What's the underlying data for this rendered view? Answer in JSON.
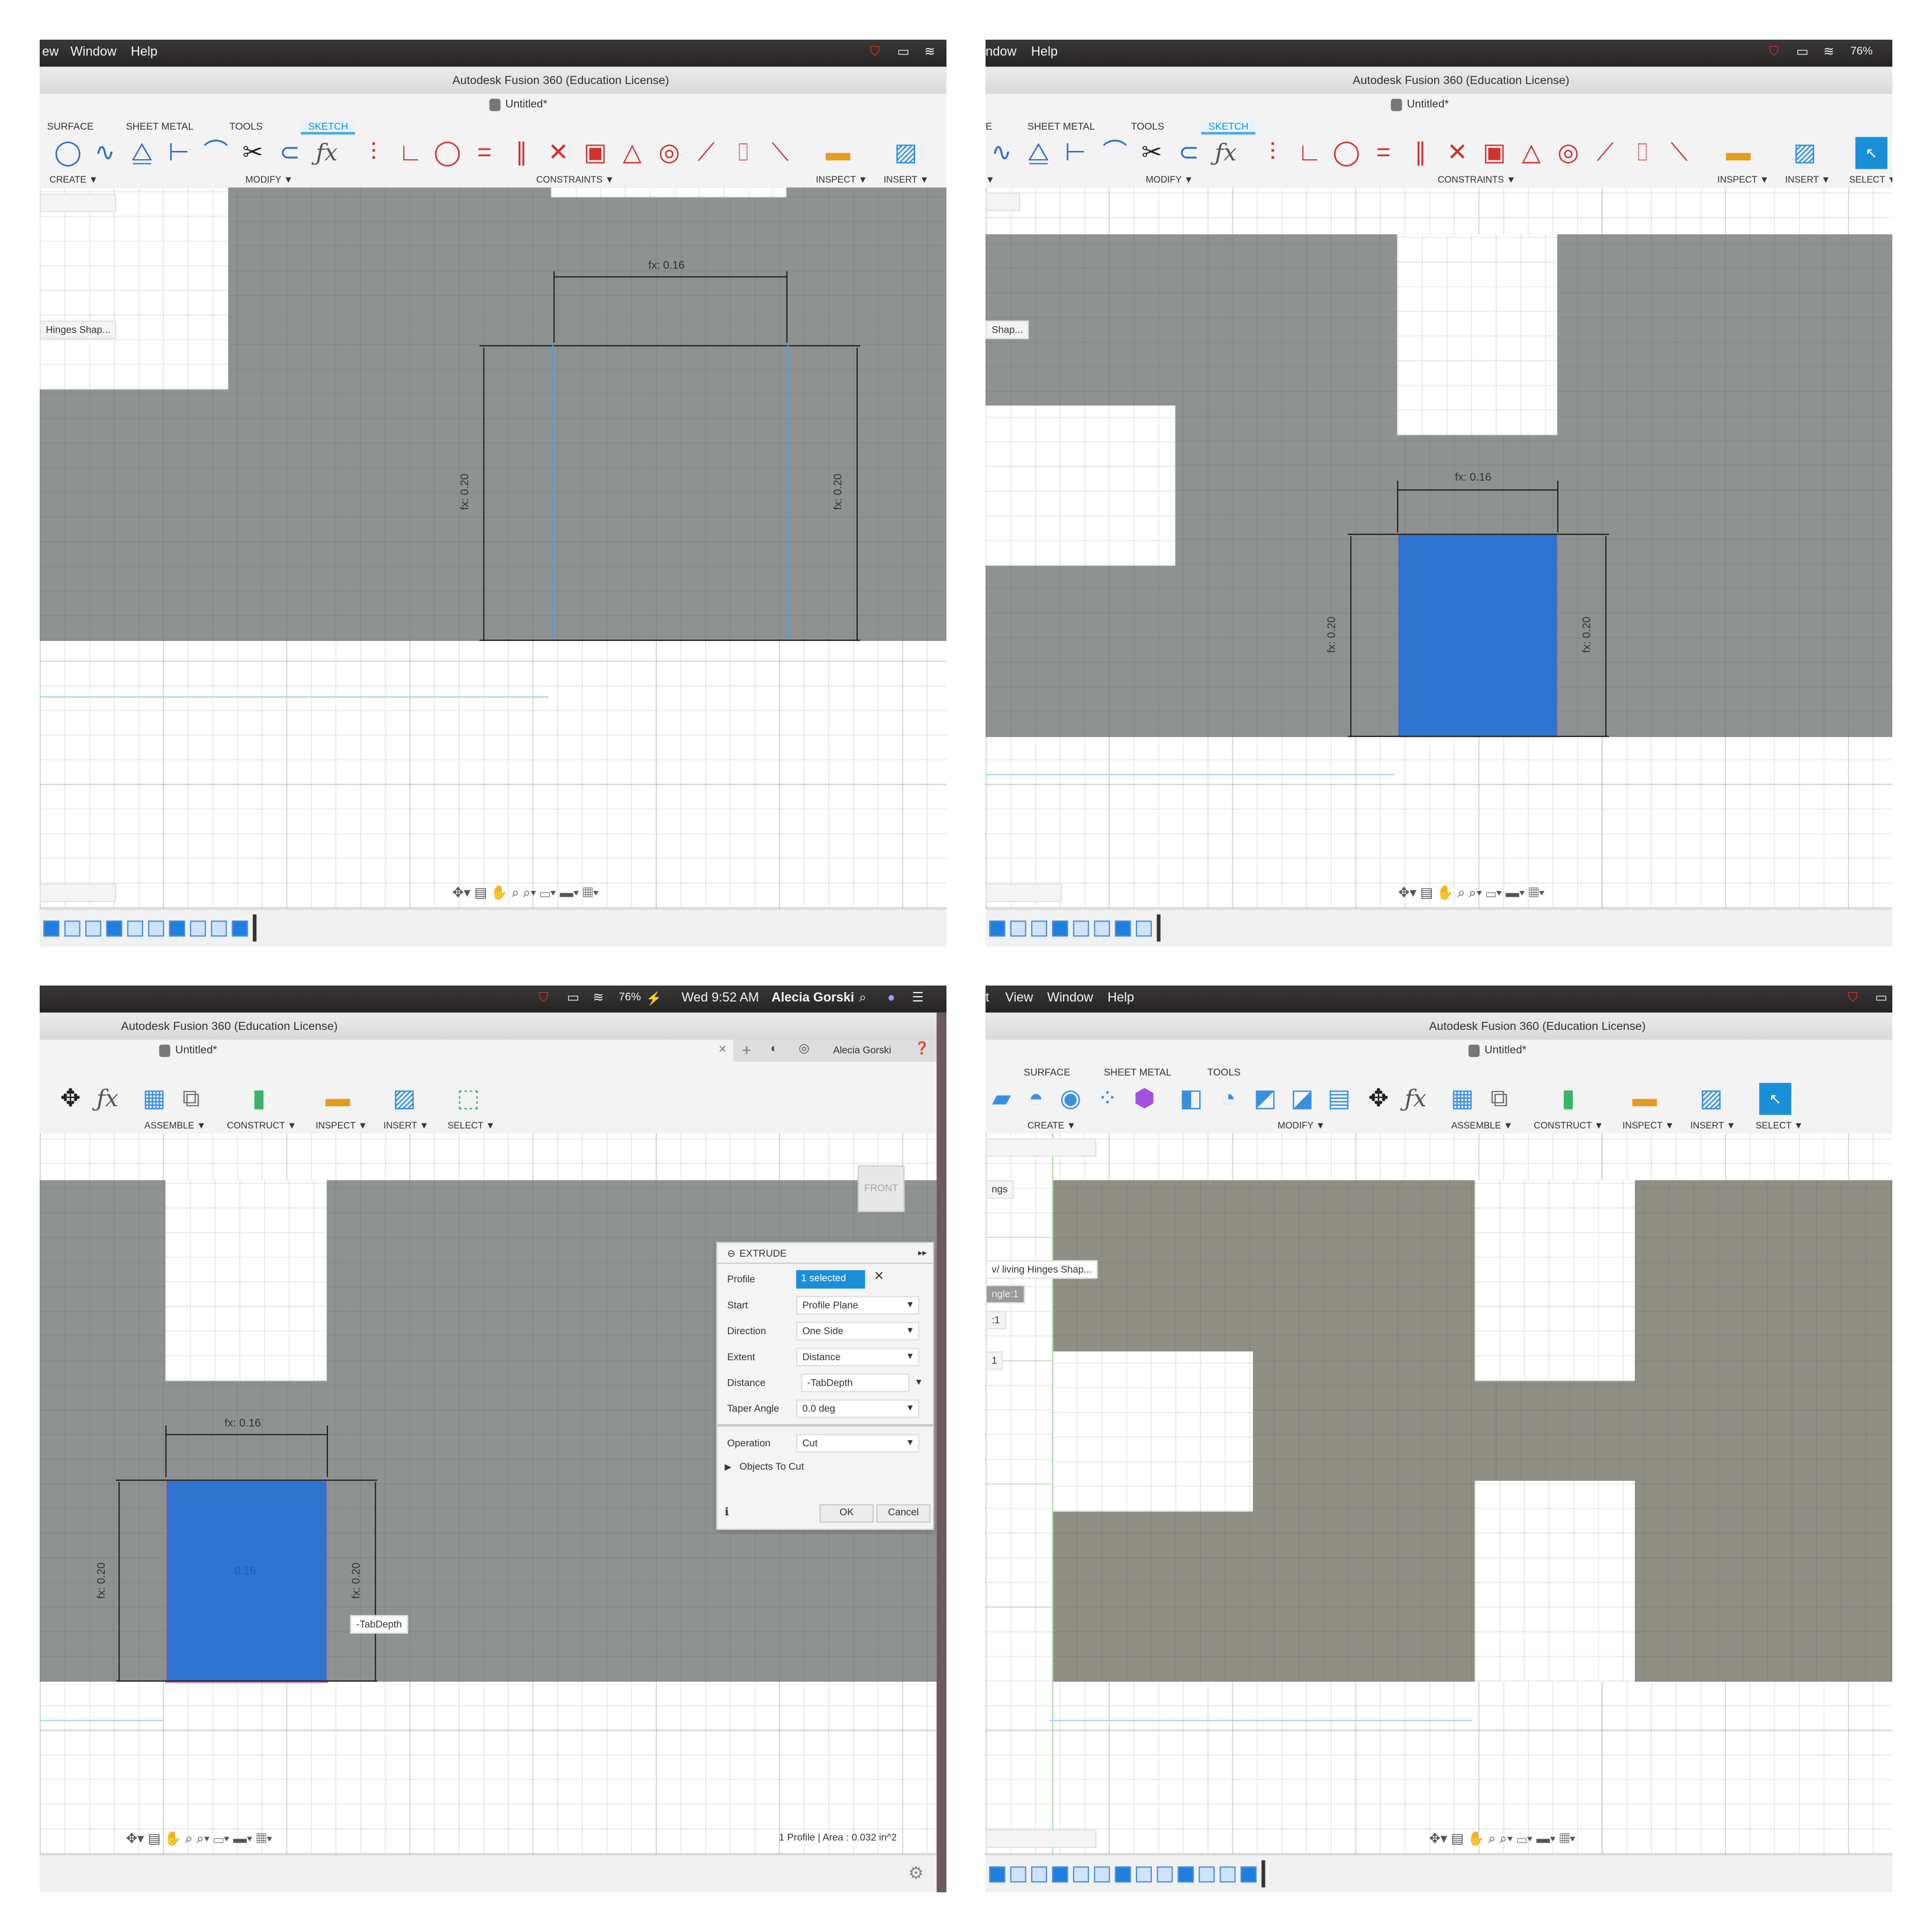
{
  "colors": {
    "accent": "#1a8fd8",
    "sketch_gray": "#8e9391",
    "body_gray": "#908f86",
    "profile_blue": "#2e73d0",
    "selection_red": "#e0707a",
    "menubar": "#2c2a2b"
  },
  "panels": [
    {
      "menubar_left": [
        "ew",
        "Window",
        "Help"
      ],
      "menubar_right_icons": [
        "mcafee-icon",
        "airplay-icon",
        "wifi-icon"
      ],
      "title": "Autodesk Fusion 360 (Education License)",
      "doc_tab": "Untitled*",
      "tabs": [
        "SURFACE",
        "SHEET METAL",
        "TOOLS",
        "SKETCH"
      ],
      "active_tab": 3,
      "groups": [
        "CREATE ▼",
        "MODIFY ▼",
        "CONSTRAINTS ▼",
        "INSPECT ▼",
        "INSERT ▼"
      ],
      "icons": [
        {
          "name": "circle-icon",
          "glyph": "◯",
          "color": "#2a6fc9"
        },
        {
          "name": "spline-icon",
          "glyph": "∿",
          "color": "#2a6fc9"
        },
        {
          "name": "mirror-icon",
          "glyph": "⧋",
          "color": "#2a6fc9"
        },
        {
          "name": "sketch-dimension-icon",
          "glyph": "⊢",
          "color": "#2a6fc9"
        },
        {
          "name": "fillet-icon",
          "glyph": "⌒",
          "color": "#2a6fc9"
        },
        {
          "name": "trim-icon",
          "glyph": "✂",
          "color": "#222"
        },
        {
          "name": "offset-icon",
          "glyph": "⊂",
          "color": "#2a6fc9"
        },
        {
          "name": "fx-icon",
          "glyph": "ƒx",
          "color": "#555"
        },
        {
          "name": "fix-constraint-icon",
          "glyph": "⫶",
          "color": "#d23030"
        },
        {
          "name": "perpendicular-icon",
          "glyph": "∟",
          "color": "#d23030"
        },
        {
          "name": "tangent-icon",
          "glyph": "◯",
          "color": "#d23030"
        },
        {
          "name": "equal-icon",
          "glyph": "=",
          "color": "#d23030"
        },
        {
          "name": "parallel-icon",
          "glyph": "∥",
          "color": "#d23030"
        },
        {
          "name": "collinear-icon",
          "glyph": "✕",
          "color": "#d23030"
        },
        {
          "name": "lock-icon",
          "glyph": "▣",
          "color": "#d23030"
        },
        {
          "name": "triangle-icon",
          "glyph": "△",
          "color": "#d23030"
        },
        {
          "name": "concentric-icon",
          "glyph": "◎",
          "color": "#d23030"
        },
        {
          "name": "midpoint-icon",
          "glyph": "⟋",
          "color": "#d23030"
        },
        {
          "name": "symmetry-icon",
          "glyph": "⌷",
          "color": "#d23030"
        },
        {
          "name": "smooth-icon",
          "glyph": "⟍",
          "color": "#d23030"
        },
        {
          "name": "measure-icon",
          "glyph": "▬",
          "color": "#e59a20"
        },
        {
          "name": "insert-image-icon",
          "glyph": "▨",
          "color": "#2a8fe0"
        }
      ],
      "browser": [
        "Hinges Shap..."
      ],
      "dims": {
        "width": "fx: 0.16",
        "height_left": "fx: 0.20",
        "height_right": "fx: 0.20"
      }
    },
    {
      "menubar_left": [
        "ndow",
        "Help"
      ],
      "menubar_right": [
        "76%"
      ],
      "title": "Autodesk Fusion 360 (Education License)",
      "doc_tab": "Untitled*",
      "tabs": [
        "E",
        "SHEET METAL",
        "TOOLS",
        "SKETCH"
      ],
      "active_tab": 3,
      "groups": [
        "▼",
        "MODIFY ▼",
        "CONSTRAINTS ▼",
        "INSPECT ▼",
        "INSERT ▼",
        "SELECT ▼"
      ],
      "icons": [
        {
          "name": "spline-icon",
          "glyph": "∿",
          "color": "#2a6fc9"
        },
        {
          "name": "mirror-icon",
          "glyph": "⧋",
          "color": "#2a6fc9"
        },
        {
          "name": "sketch-dimension-icon",
          "glyph": "⊢",
          "color": "#2a6fc9"
        },
        {
          "name": "fillet-icon",
          "glyph": "⌒",
          "color": "#2a6fc9"
        },
        {
          "name": "trim-icon",
          "glyph": "✂",
          "color": "#222"
        },
        {
          "name": "offset-icon",
          "glyph": "⊂",
          "color": "#2a6fc9"
        },
        {
          "name": "fx-icon",
          "glyph": "ƒx",
          "color": "#555"
        },
        {
          "name": "fix-constraint-icon",
          "glyph": "⫶",
          "color": "#d23030"
        },
        {
          "name": "perpendicular-icon",
          "glyph": "∟",
          "color": "#d23030"
        },
        {
          "name": "tangent-icon",
          "glyph": "◯",
          "color": "#d23030"
        },
        {
          "name": "equal-icon",
          "glyph": "=",
          "color": "#d23030"
        },
        {
          "name": "parallel-icon",
          "glyph": "∥",
          "color": "#d23030"
        },
        {
          "name": "collinear-icon",
          "glyph": "✕",
          "color": "#d23030"
        },
        {
          "name": "lock-icon",
          "glyph": "▣",
          "color": "#d23030"
        },
        {
          "name": "triangle-icon",
          "glyph": "△",
          "color": "#d23030"
        },
        {
          "name": "concentric-icon",
          "glyph": "◎",
          "color": "#d23030"
        },
        {
          "name": "midpoint-icon",
          "glyph": "⟋",
          "color": "#d23030"
        },
        {
          "name": "symmetry-icon",
          "glyph": "⌷",
          "color": "#d23030"
        },
        {
          "name": "smooth-icon",
          "glyph": "⟍",
          "color": "#d23030"
        },
        {
          "name": "measure-icon",
          "glyph": "▬",
          "color": "#e59a20"
        },
        {
          "name": "insert-image-icon",
          "glyph": "▨",
          "color": "#2a8fe0"
        },
        {
          "name": "select-icon",
          "glyph": "▪",
          "color": "#1a8fd8"
        }
      ],
      "browser": [
        "Shap..."
      ],
      "dims": {
        "width": "fx: 0.16",
        "height_left": "fx: 0.20",
        "height_right": "fx: 0.20"
      }
    },
    {
      "menubar_right": [
        "76%",
        "Wed 9:52 AM",
        "Alecia Gorski"
      ],
      "menubar_right_icons": [
        "mcafee-icon",
        "airplay-icon",
        "wifi-icon",
        "battery-icon",
        "search-icon",
        "siri-icon",
        "list-icon"
      ],
      "title": "Autodesk Fusion 360 (Education License)",
      "doc_tab": "Untitled*",
      "user": "Alecia Gorski",
      "groups": [
        "ASSEMBLE ▼",
        "CONSTRUCT ▼",
        "INSPECT ▼",
        "INSERT ▼",
        "SELECT ▼"
      ],
      "icons": [
        {
          "name": "move-icon",
          "glyph": "✥",
          "color": "#222"
        },
        {
          "name": "fx-icon",
          "glyph": "ƒx",
          "color": "#555"
        },
        {
          "name": "new-component-icon",
          "glyph": "▦",
          "color": "#3a8fe0"
        },
        {
          "name": "joint-icon",
          "glyph": "⧉",
          "color": "#777"
        },
        {
          "name": "construct-plane-icon",
          "glyph": "▮",
          "color": "#3bb36a"
        },
        {
          "name": "measure-icon",
          "glyph": "▬",
          "color": "#e59a20"
        },
        {
          "name": "insert-image-icon",
          "glyph": "▨",
          "color": "#2a8fe0"
        },
        {
          "name": "select-icon",
          "glyph": "⬚",
          "color": "#3bb36a"
        }
      ],
      "viewcube": "FRONT",
      "dims": {
        "width": "fx: 0.16",
        "height_left": "fx: 0.20",
        "height_right": "fx: 0.20",
        "center": "0.16"
      },
      "tooltip": "-TabDepth",
      "extrude": {
        "title": "EXTRUDE",
        "rows": [
          {
            "label": "Profile",
            "value": "1 selected"
          },
          {
            "label": "Start",
            "value": "Profile Plane"
          },
          {
            "label": "Direction",
            "value": "One Side"
          },
          {
            "label": "Extent",
            "value": "Distance"
          },
          {
            "label": "Distance",
            "value": "-TabDepth"
          },
          {
            "label": "Taper Angle",
            "value": "0.0 deg"
          },
          {
            "label": "Operation",
            "value": "Cut"
          }
        ],
        "objects": "Objects To Cut",
        "ok": "OK",
        "cancel": "Cancel"
      },
      "status": "1 Profile | Area : 0.032 in^2"
    },
    {
      "menubar_left": [
        "t",
        "View",
        "Window",
        "Help"
      ],
      "title": "Autodesk Fusion 360 (Education License)",
      "doc_tab": "Untitled*",
      "tabs": [
        "SURFACE",
        "SHEET METAL",
        "TOOLS"
      ],
      "groups": [
        "CREATE ▼",
        "MODIFY ▼",
        "ASSEMBLE ▼",
        "CONSTRUCT ▼",
        "INSPECT ▼",
        "INSERT ▼",
        "SELECT ▼"
      ],
      "icons": [
        {
          "name": "extrude-icon",
          "glyph": "▰",
          "color": "#3a8fe0"
        },
        {
          "name": "revolve-icon",
          "glyph": "◓",
          "color": "#3a8fe0"
        },
        {
          "name": "hole-icon",
          "glyph": "◉",
          "color": "#3a8fe0"
        },
        {
          "name": "pattern-icon",
          "glyph": "⁘",
          "color": "#3a8fe0"
        },
        {
          "name": "create-form-icon",
          "glyph": "⬢",
          "color": "#a050e0"
        },
        {
          "name": "press-pull-icon",
          "glyph": "◧",
          "color": "#3a8fe0"
        },
        {
          "name": "fillet-icon",
          "glyph": "◔",
          "color": "#3a8fe0"
        },
        {
          "name": "chamfer-icon",
          "glyph": "◩",
          "color": "#3a8fe0"
        },
        {
          "name": "shell-icon",
          "glyph": "◪",
          "color": "#3a8fe0"
        },
        {
          "name": "combine-icon",
          "glyph": "▤",
          "color": "#3a8fe0"
        },
        {
          "name": "move-icon",
          "glyph": "✥",
          "color": "#222"
        },
        {
          "name": "fx-icon",
          "glyph": "ƒx",
          "color": "#555"
        },
        {
          "name": "new-component-icon",
          "glyph": "▦",
          "color": "#3a8fe0"
        },
        {
          "name": "joint-icon",
          "glyph": "⧉",
          "color": "#777"
        },
        {
          "name": "construct-plane-icon",
          "glyph": "▮",
          "color": "#3bb36a"
        },
        {
          "name": "measure-icon",
          "glyph": "▬",
          "color": "#e59a20"
        },
        {
          "name": "insert-image-icon",
          "glyph": "▨",
          "color": "#2a8fe0"
        },
        {
          "name": "select-icon",
          "glyph": "▪",
          "color": "#1a8fd8"
        }
      ],
      "browser": [
        "ngs",
        "v/ living Hinges Shap...",
        "ngle:1",
        ":1",
        "1"
      ]
    }
  ]
}
